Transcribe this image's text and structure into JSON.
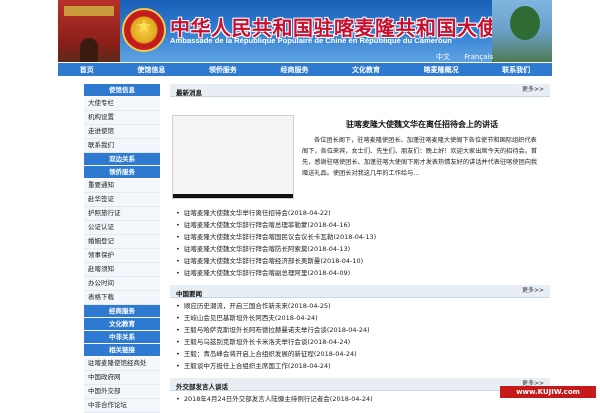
{
  "banner": {
    "title": "中华人民共和国驻喀麦隆共和国大使馆",
    "subtitle": "Ambassade de la République Populaire de Chine en République du Cameroun",
    "lang_zh": "中文",
    "lang_fr": "Français"
  },
  "nav": [
    "首页",
    "使馆信息",
    "领侨服务",
    "经商服务",
    "文化教育",
    "喀麦隆概况",
    "联系我们"
  ],
  "sidebar": {
    "sections": [
      {
        "title": "使馆信息",
        "items": [
          "大使专栏",
          "机构设置",
          "走进使馆",
          "联系我们"
        ]
      },
      {
        "title": "双边关系",
        "items": []
      },
      {
        "title": "领侨服务",
        "items": [
          "重要通知",
          "赴华签证",
          "护照旅行证",
          "公证认证",
          "婚姻登记",
          "领事保护",
          "赴喀须知",
          "办公时间",
          "表格下载"
        ]
      },
      {
        "title": "经商服务",
        "items": []
      },
      {
        "title": "文化教育",
        "items": []
      },
      {
        "title": "中非关系",
        "items": []
      },
      {
        "title": "相关链接",
        "items": [
          "驻喀麦隆使馆经商处",
          "中国政府网",
          "中国外交部",
          "中非合作论坛"
        ]
      }
    ]
  },
  "latest": {
    "title": "最新消息",
    "more": "更多>>",
    "headline": "驻喀麦隆大使魏文华在离任招待会上的讲话",
    "body": "各位团长阁下，驻喀麦隆使团长、加蓬驻喀麦隆大使阁下各位使节和国际组织代表阁下，各位来宾，女士们、先生们、朋友们：晚上好！欢迎大家出席今天的招待会。首先，感谢驻喀使团长、加蓬驻喀大使阁下刚才发表热情友好的讲话并代表驻喀使团向我赠送礼品。使团长对我这几年的工作给与...",
    "items": [
      "驻喀麦隆大使魏文华举行离任招待会(2018-04-22)",
      "驻喀麦隆大使魏文华辞行拜会喀总理菲勒蒙(2018-04-16)",
      "驻喀麦隆大使魏文华辞行拜会喀国民议会议长卡瓦勒(2018-04-13)",
      "驻喀麦隆大使魏文华辞行拜会喀防长阿索莫(2018-04-13)",
      "驻喀麦隆大使魏文华辞行拜会喀经济部长奥斯曼(2018-04-10)",
      "驻喀麦隆大使魏文华辞行拜会喀副总理阿里(2018-04-09)"
    ]
  },
  "china_news": {
    "title": "中国要闻",
    "more": "更多>>",
    "items": [
      "顺应历史潮流，开启三国合作新未来(2018-04-25)",
      "王岐山会见巴基斯坦外长阿西夫(2018-04-24)",
      "王毅与哈萨克斯坦外长阿布德拉赫曼诺夫举行会谈(2018-04-24)",
      "王毅与乌兹别克斯坦外长卡米洛夫举行会谈(2018-04-24)",
      "王毅：青岛峰会将开启上合组织发展的新征程(2018-04-24)",
      "王毅谈中方担任上合组织主席国工作(2018-04-24)"
    ]
  },
  "spokesperson": {
    "title": "外交部发言人谈话",
    "more": "更多>>",
    "items": [
      "2018年4月24日外交部发言人陆慷主持例行记者会(2018-04-24)"
    ]
  },
  "watermark": "www.KUJIW.com",
  "colors": {
    "nav": "#2e7ad0",
    "title": "#c8102e",
    "section": "#e9eef4"
  }
}
